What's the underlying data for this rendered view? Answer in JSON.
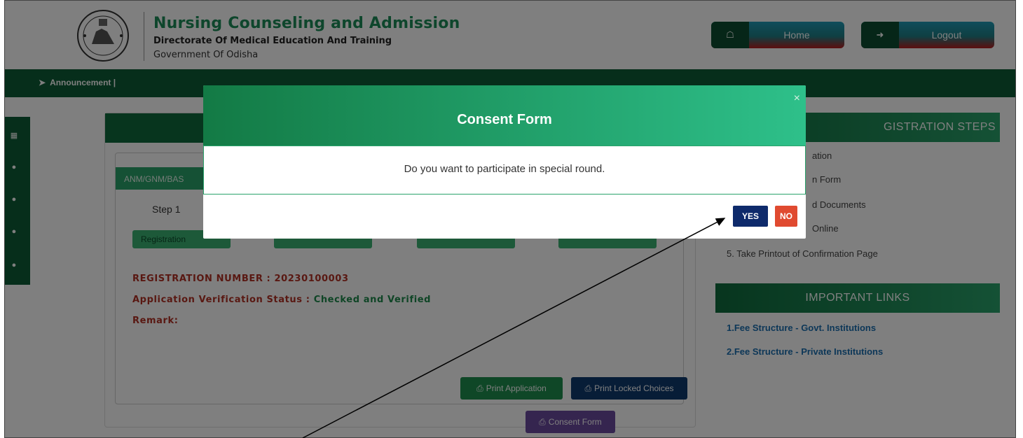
{
  "header": {
    "title": "Nursing Counseling and Admission",
    "subtitle1": "Directorate Of Medical Education And Training",
    "subtitle2": "Government Of Odisha",
    "home_label": "Home",
    "logout_label": "Logout"
  },
  "navbar": {
    "announcement": "Announcement |"
  },
  "main": {
    "tab_label": "ANM/GNM/BAS",
    "step1": "Step 1",
    "step_btn1": "Registration",
    "reg_number_label": "REGISTRATION NUMBER :",
    "reg_number_value": "20230100003",
    "verif_label": "Application Verification Status :",
    "verif_value": "Checked and Verified",
    "remark_label": "Remark:",
    "print_app": "Print Application",
    "print_locked": "Print Locked Choices",
    "consent_form": "Consent Form"
  },
  "right": {
    "steps_head": "GISTRATION STEPS",
    "steps": [
      "ation",
      "n Form",
      "d Documents",
      "Online",
      "5. Take Printout of Confirmation Page"
    ],
    "links_head": "IMPORTANT LINKS",
    "links": [
      "1.Fee Structure - Govt. Institutions",
      "2.Fee Structure - Private Institutions"
    ]
  },
  "modal": {
    "title": "Consent Form",
    "close": "×",
    "message": "Do you want to participate in special round.",
    "yes": "YES",
    "no": "NO"
  },
  "colors": {
    "brand_green": "#0d5d36",
    "accent_green": "#2aa36b",
    "yes_blue": "#0e2a6b",
    "no_red": "#e04a30"
  }
}
